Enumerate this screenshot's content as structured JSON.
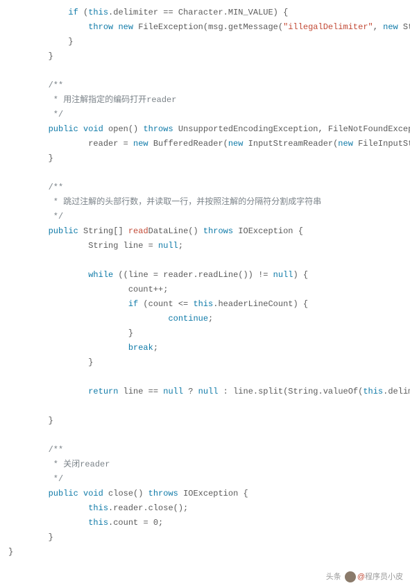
{
  "code": {
    "line1": "            if (this.delimiter == Character.MIN_VALUE) {",
    "line1_kw": "if",
    "line2": "                throw new FileException(msg.getMessage(\"illegalDelimiter\", new Str",
    "line2_kw1": "throw",
    "line2_kw2": "new",
    "line2_str": "\"illegalDelimiter\"",
    "line2_kw3": "new",
    "line3": "            }",
    "line4": "        }",
    "comment1_l1": "        /**",
    "comment1_l2": "         * 用注解指定的编码打开reader",
    "comment1_l3": "         */",
    "line5": "        public void open() throws UnsupportedEncodingException, FileNotFoundException",
    "line5_kw1": "public",
    "line5_kw2": "void",
    "line5_kw3": "throws",
    "line6": "                reader = new BufferedReader(new InputStreamReader(new FileInputStream(",
    "line6_kw1": "new",
    "line6_kw2": "new",
    "line6_kw3": "new",
    "line7": "        }",
    "comment2_l1": "        /**",
    "comment2_l2": "         * 跳过注解的头部行数，并读取一行，并按照注解的分隔符分割成字符串",
    "comment2_l3": "         */",
    "line8": "        public String[] readDataLine() throws IOException {",
    "line8_kw1": "public",
    "line8_fn": "read",
    "line8_kw2": "throws",
    "line9": "                String line = null;",
    "line9_kw": "null",
    "line10": "                while ((line = reader.readLine()) != null) {",
    "line10_kw1": "while",
    "line10_kw2": "null",
    "line11": "                        count++;",
    "line12": "                        if (count <= this.headerLineCount) {",
    "line12_kw": "if",
    "line13": "                                continue;",
    "line13_kw": "continue",
    "line14": "                        }",
    "line15": "                        break;",
    "line15_kw": "break",
    "line16": "                }",
    "line17": "                return line == null ? null : line.split(String.valueOf(this.delimiter)",
    "line17_kw1": "return",
    "line17_kw2": "null",
    "line17_kw3": "null",
    "line18": "        }",
    "comment3_l1": "        /**",
    "comment3_l2": "         * 关闭reader",
    "comment3_l3": "         */",
    "line19": "        public void close() throws IOException {",
    "line19_kw1": "public",
    "line19_kw2": "void",
    "line19_kw3": "throws",
    "line20": "                this.reader.close();",
    "line21": "                this.count = 0;",
    "line22": "        }",
    "line23": "}"
  },
  "footer": {
    "brand": "头条",
    "at": "@",
    "name": "程序员小皮"
  }
}
